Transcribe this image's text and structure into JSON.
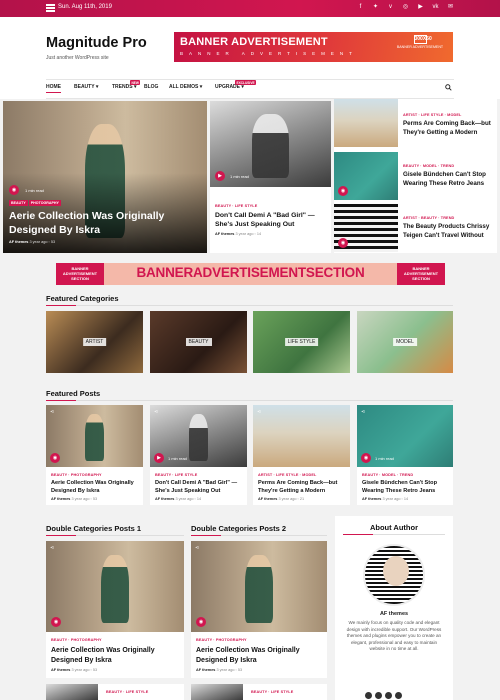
{
  "topbar": {
    "date": "Sun. Aug 11th, 2019",
    "social": [
      "facebook-icon",
      "twitter-icon",
      "vimeo-icon",
      "instagram-icon",
      "youtube-icon",
      "vk-icon",
      "mail-icon"
    ]
  },
  "header": {
    "logo": "Magnitude Pro",
    "tagline": "Just another WordPress site",
    "banner": {
      "title": "BANNER ADVERTISEMENT",
      "sub": "BANNER ADVERTISEMENT",
      "logo_text": "BANNER ADVERTISEMENT",
      "logo_size": "300X50"
    }
  },
  "nav": {
    "items": [
      "HOME",
      "BEAUTY",
      "TRENDS",
      "BLOG",
      "ALL DEMOS",
      "UPGRADE"
    ],
    "badges": {
      "trends": "NEW",
      "upgrade": "EXCLUSIVE"
    }
  },
  "hero": {
    "main": {
      "cats": [
        "BEAUTY",
        "PHOTOGRAPHY"
      ],
      "title": "Aerie Collection Was Originally Designed By Iskra",
      "author": "AF themes",
      "time": "3 year ago",
      "comments": "53",
      "read": "1 min read"
    },
    "second": {
      "cats": "BEAUTY · LIFE STYLE",
      "title": "Don't Call Demi A \"Bad Girl\" — She's Just Speaking Out",
      "author": "AF themes",
      "time": "3 year ago",
      "comments": "14",
      "read": "1 min read"
    },
    "side": [
      {
        "cats": "ARTIST · LIFE STYLE · MODEL",
        "title": "Perms Are Coming Back—but They're Getting a Modern"
      },
      {
        "cats": "BEAUTY · MODEL · TREND",
        "title": "Gisele Bündchen Can't Stop Wearing These Retro Jeans"
      },
      {
        "cats": "ARTIST · BEAUTY · TREND",
        "title": "The Beauty Products Chrissy Teigen Can't Travel Without"
      }
    ]
  },
  "banner_mid": {
    "left": "BANNER ADVERTISEMENT SECTION",
    "center": "BANNERADVERTISEMENTSECTION",
    "right": "BANNER ADVERTISEMENT SECTION"
  },
  "featured_categories": {
    "title": "Featured Categories",
    "items": [
      "ARTIST",
      "BEAUTY",
      "LIFE STYLE",
      "MODEL"
    ]
  },
  "featured_posts": {
    "title": "Featured Posts",
    "items": [
      {
        "cats": "BEAUTY · PHOTOGRAPHY",
        "title": "Aerie Collection Was Originally Designed By Iskra",
        "author": "AF themes",
        "time": "3 year ago",
        "comments": "53",
        "read": ""
      },
      {
        "cats": "BEAUTY · LIFE STYLE",
        "title": "Don't Call Demi A \"Bad Girl\" — She's Just Speaking Out",
        "author": "AF themes",
        "time": "3 year ago",
        "comments": "14",
        "read": "1 min read"
      },
      {
        "cats": "ARTIST · LIFE STYLE · MODEL",
        "title": "Perms Are Coming Back—but They're Getting a Modern",
        "author": "AF themes",
        "time": "3 year ago",
        "comments": "21",
        "read": ""
      },
      {
        "cats": "BEAUTY · MODEL · TREND",
        "title": "Gisele Bündchen Can't Stop Wearing These Retro Jeans",
        "author": "AF themes",
        "time": "3 year ago",
        "comments": "14",
        "read": "1 min read"
      }
    ]
  },
  "double1": {
    "title": "Double Categories Posts 1",
    "cats": "BEAUTY · PHOTOGRAPHY",
    "post": "Aerie Collection Was Originally Designed By Iskra",
    "author": "AF themes",
    "time": "3 year ago",
    "comments": "53",
    "next_cats": "BEAUTY · LIFE STYLE"
  },
  "double2": {
    "title": "Double Categories Posts 2",
    "cats": "BEAUTY · PHOTOGRAPHY",
    "post": "Aerie Collection Was Originally Designed By Iskra",
    "author": "AF themes",
    "time": "3 year ago",
    "comments": "53",
    "next_cats": "BEAUTY · LIFE STYLE"
  },
  "about": {
    "title": "About Author",
    "name": "AF themes",
    "text": "We mainly focus on quality code and elegant design with incredible support. Our WordPress themes and plugins empower you to create an elegant, professional and easy to maintain website in no time at all."
  },
  "colors": {
    "accent": "#d1164f"
  }
}
